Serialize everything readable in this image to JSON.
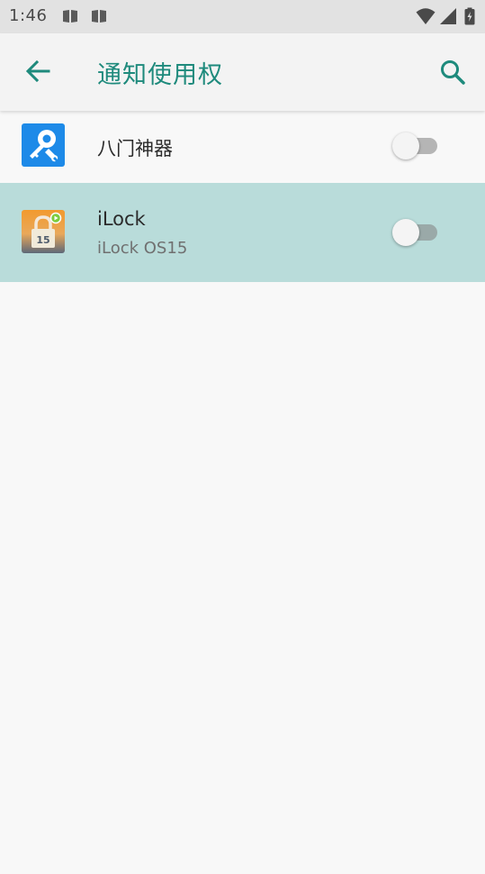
{
  "status_bar": {
    "time": "1:46"
  },
  "app_bar": {
    "title": "通知使用权"
  },
  "apps": [
    {
      "name": "八门神器",
      "subtitle": "",
      "enabled": false
    },
    {
      "name": "iLock",
      "subtitle": "iLock OS15",
      "enabled": false,
      "icon_badge": "15"
    }
  ],
  "colors": {
    "accent": "#1e8a7c",
    "highlight_row": "#b9dcda",
    "status_bar": "#e2e2e2",
    "app_bar": "#f3f3f3",
    "background": "#f8f8f8"
  }
}
